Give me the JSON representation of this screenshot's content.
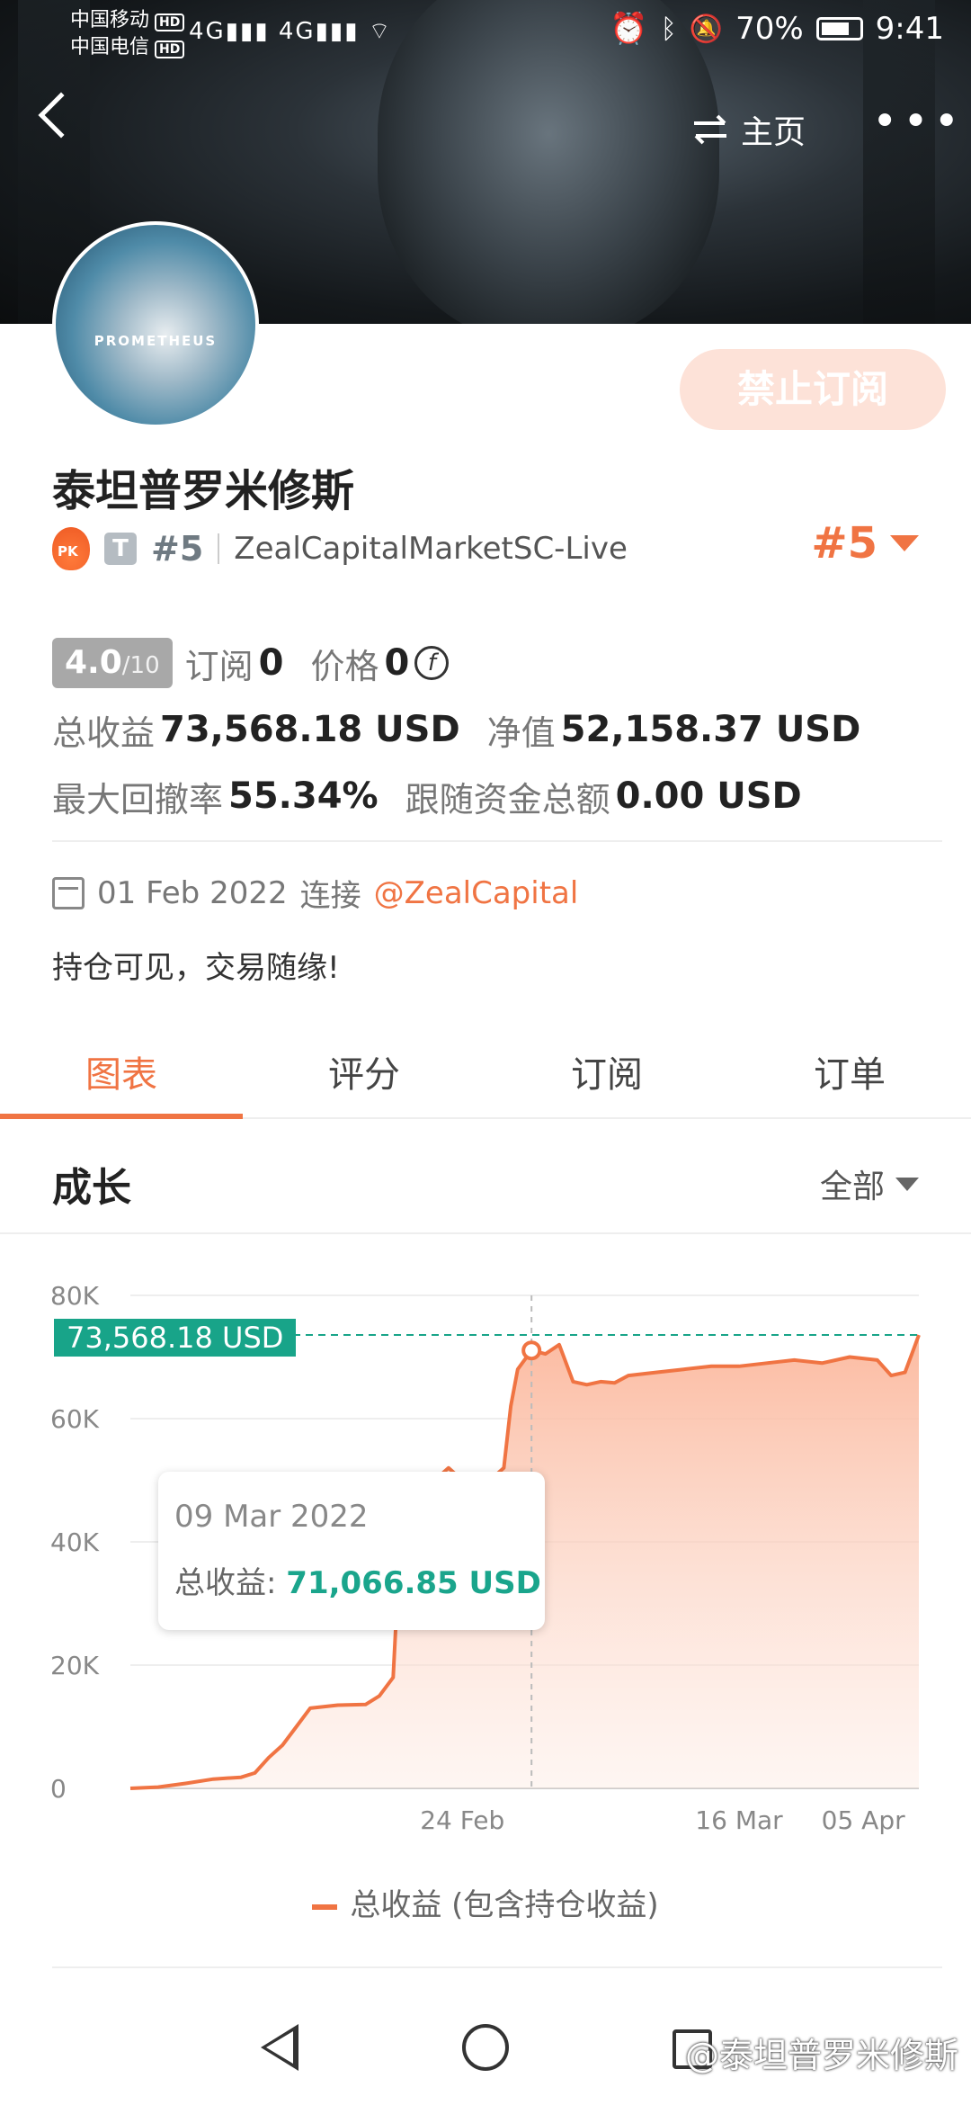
{
  "status": {
    "carrier1": "中国移动",
    "carrier2": "中国电信",
    "hd": "HD",
    "network": "4G",
    "battery": "70%",
    "time": "9:41"
  },
  "nav": {
    "home_label": "主页",
    "more": "•••"
  },
  "avatar_text": "PROMETHEUS",
  "subscribe_button": "禁止订阅",
  "profile": {
    "name": "泰坦普罗米修斯",
    "pk_badge": "PK",
    "type_badge": "T",
    "rank_small": "#5",
    "server": "ZealCapitalMarketSC-Live",
    "rank_big": "#5"
  },
  "stats": {
    "score_value": "4.0",
    "score_max": "/10",
    "subscribe_label": "订阅",
    "subscribe_count": "0",
    "price_label": "价格",
    "price_value": "0",
    "coin_symbol": "f",
    "total_profit_label": "总收益",
    "total_profit": "73,568.18 USD",
    "equity_label": "净值",
    "equity": "52,158.37 USD",
    "max_drawdown_label": "最大回撤率",
    "max_drawdown": "55.34%",
    "follow_funds_label": "跟随资金总额",
    "follow_funds": "0.00 USD"
  },
  "connection": {
    "date": "01 Feb 2022",
    "connect_label": "连接",
    "mention": "@ZealCapital"
  },
  "description": "持仓可见，交易随缘!",
  "tabs": [
    "图表",
    "评分",
    "订阅",
    "订单"
  ],
  "section": {
    "title": "成长",
    "filter": "全部"
  },
  "tooltip": {
    "date": "09 Mar 2022",
    "label": "总收益:",
    "value": "71,066.85 USD"
  },
  "price_tag": "73,568.18 USD",
  "legend": "总收益 (包含持仓收益)",
  "watermark": "@泰坦普罗米修斯",
  "colors": {
    "accent": "#f07443",
    "teal": "#18a489",
    "fill_top": "#fbb79c"
  },
  "chart_data": {
    "type": "area",
    "title": "",
    "xlabel": "",
    "ylabel": "",
    "ylim": [
      0,
      80000
    ],
    "yticks": [
      "0",
      "20K",
      "40K",
      "60K",
      "80K"
    ],
    "xticks": [
      "24 Feb",
      "16 Mar",
      "05 Apr"
    ],
    "series": [
      {
        "name": "总收益 (包含持仓收益)",
        "x": [
          0,
          2,
          4,
          6,
          8,
          9,
          10,
          11,
          12,
          13,
          15,
          17,
          18,
          19,
          19.5,
          20,
          21,
          22,
          23,
          24,
          25,
          26,
          27,
          27.5,
          28,
          29,
          30,
          31,
          32,
          33,
          34,
          35,
          36,
          38,
          40,
          42,
          44,
          46,
          48,
          50,
          52,
          54,
          55,
          56,
          57
        ],
        "values": [
          0,
          200,
          800,
          1500,
          1800,
          2500,
          5000,
          7000,
          10000,
          13000,
          13500,
          13600,
          15000,
          18000,
          40000,
          44000,
          47000,
          50000,
          52000,
          50000,
          49000,
          50000,
          52000,
          62000,
          68000,
          71066,
          70500,
          72000,
          66000,
          65500,
          66000,
          65800,
          67000,
          67500,
          68000,
          68500,
          68500,
          69000,
          69500,
          69000,
          70000,
          69500,
          67000,
          67500,
          73568
        ]
      }
    ],
    "reference_line": 73568.18,
    "highlight_point": {
      "date": "09 Mar 2022",
      "value": 71066.85
    }
  }
}
